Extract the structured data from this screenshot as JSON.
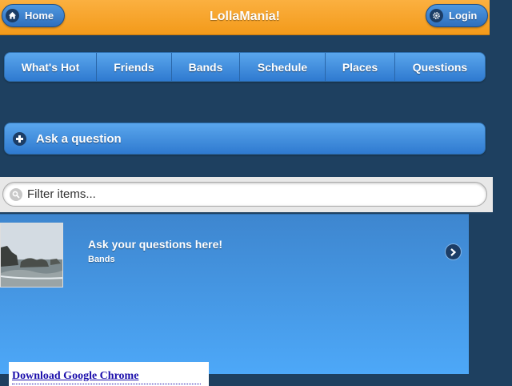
{
  "header": {
    "title": "LollaMania!",
    "home_label": "Home",
    "login_label": "Login"
  },
  "nav": {
    "tabs": [
      {
        "label": "What's Hot"
      },
      {
        "label": "Friends"
      },
      {
        "label": "Bands"
      },
      {
        "label": "Schedule"
      },
      {
        "label": "Places"
      },
      {
        "label": "Questions"
      }
    ]
  },
  "ask": {
    "label": "Ask a question"
  },
  "filter": {
    "placeholder": "Filter items..."
  },
  "list": {
    "items": [
      {
        "title": "Ask your questions here!",
        "subtitle": "Bands"
      }
    ]
  },
  "ad": {
    "link_text": "Download Google Chrome"
  },
  "colors": {
    "header": "#f39a1a",
    "button_blue": "#2f7ad0",
    "page_bg": "#1e4060"
  }
}
